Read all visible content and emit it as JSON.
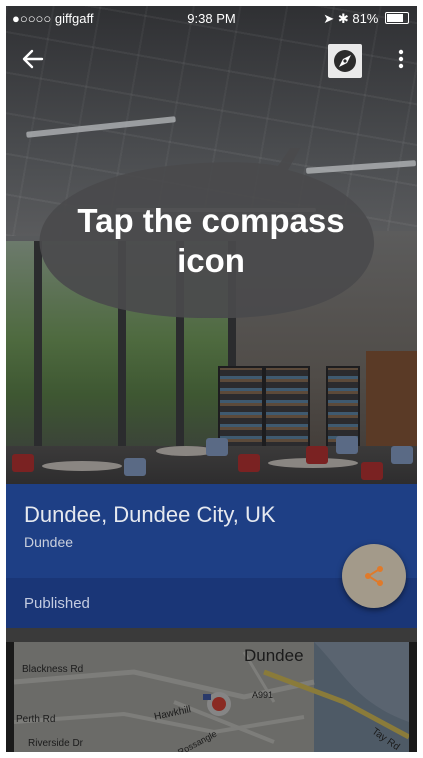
{
  "status_bar": {
    "carrier": "●○○○○ giffgaff",
    "time": "9:38 PM",
    "battery": "81%"
  },
  "toolbar": {
    "back_icon": "arrow-left-icon",
    "compass_icon": "compass-icon",
    "menu_icon": "more-vert-icon"
  },
  "callout": {
    "text_line1": "Tap the compass",
    "text_line2": "icon"
  },
  "place": {
    "title": "Dundee, Dundee City, UK",
    "subtitle": "Dundee",
    "status": "Published"
  },
  "share": {
    "icon": "share-icon",
    "accent": "#e07a2a"
  },
  "map": {
    "city_label": "Dundee",
    "streets": {
      "blackness": "Blackness Rd",
      "perth": "Perth Rd",
      "hawkhill": "Hawkhill",
      "riverside": "Riverside Dr",
      "a991": "A991",
      "tay": "Tay Rd",
      "rossangle": "Rossangle"
    }
  },
  "colors": {
    "panel": "#1e3f85",
    "panel_dark": "#1a3677",
    "bubble": "#4a4a4c"
  }
}
